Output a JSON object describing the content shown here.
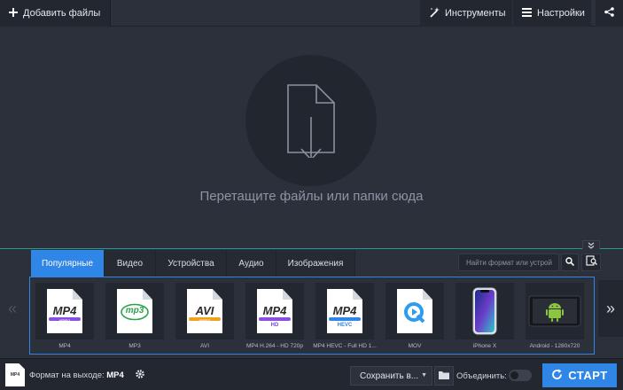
{
  "toolbar": {
    "add_files_label": "Добавить файлы",
    "tools_label": "Инструменты",
    "settings_label": "Настройки"
  },
  "dropzone": {
    "hint": "Перетащите файлы или папки сюда"
  },
  "tabs": [
    {
      "label": "Популярные",
      "active": true
    },
    {
      "label": "Видео",
      "active": false
    },
    {
      "label": "Устройства",
      "active": false
    },
    {
      "label": "Аудио",
      "active": false
    },
    {
      "label": "Изображения",
      "active": false
    }
  ],
  "search": {
    "placeholder": "Найти формат или устрой"
  },
  "formats": [
    {
      "label": "MP4",
      "badge": "MP4",
      "sub": "VIDEO"
    },
    {
      "label": "MP3",
      "badge": "mp3",
      "sub": ""
    },
    {
      "label": "AVI",
      "badge": "AVI",
      "sub": "VIDEO"
    },
    {
      "label": "MP4 H.264 - HD 720p",
      "badge": "MP4",
      "sub": "HD"
    },
    {
      "label": "MP4 HEVC - Full HD 1...",
      "badge": "MP4",
      "sub": "HEVC"
    },
    {
      "label": "MOV",
      "badge": "",
      "sub": ""
    },
    {
      "label": "iPhone X",
      "badge": "",
      "sub": ""
    },
    {
      "label": "Android - 1280x720",
      "badge": "",
      "sub": ""
    }
  ],
  "bottom": {
    "output_label": "Формат на выходе:",
    "output_value": "MP4",
    "save_label": "Сохранить в...",
    "merge_label": "Объединить:",
    "merge_on": false,
    "start_label": "СТАРТ"
  },
  "colors": {
    "accent": "#2f86e6",
    "divider": "#1e9c8f"
  }
}
